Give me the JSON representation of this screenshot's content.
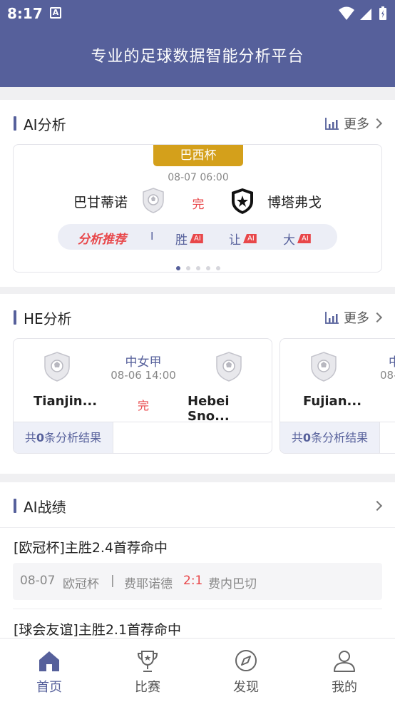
{
  "status_bar": {
    "time": "8:17",
    "notif_icon": "A"
  },
  "header": {
    "title": "专业的足球数据智能分析平台"
  },
  "ai_section": {
    "title": "AI分析",
    "more": "更多",
    "match": {
      "cup": "巴西杯",
      "datetime": "08-07 06:00",
      "home": "巴甘蒂诺",
      "away": "博塔弗戈",
      "status": "完"
    },
    "recommend": {
      "title": "分析推荐",
      "sep": "I",
      "items": [
        {
          "label": "胜",
          "badge": "AI"
        },
        {
          "label": "让",
          "badge": "AI"
        },
        {
          "label": "大",
          "badge": "AI"
        }
      ]
    },
    "pager": {
      "count": 5,
      "active": 0
    }
  },
  "he_section": {
    "title": "HE分析",
    "more": "更多",
    "matches": [
      {
        "league": "中女甲",
        "datetime": "08-06 14:00",
        "home": "Tianjin...",
        "away": "Hebei Sno...",
        "status": "完",
        "footer_prefix": "共",
        "footer_count": "0",
        "footer_suffix": "条分析结果"
      },
      {
        "league": "中",
        "datetime": "08-",
        "home": "Fujian...",
        "away": "",
        "status": "",
        "footer_prefix": "共",
        "footer_count": "0",
        "footer_suffix": "条分析结果"
      }
    ]
  },
  "record_section": {
    "title": "AI战绩",
    "items": [
      {
        "title": "[欧冠杯]主胜2.4首荐命中",
        "date": "08-07",
        "league": "欧冠杯",
        "sep": "|",
        "home": "费耶诺德",
        "score": "2:1",
        "away": "费内巴切"
      },
      {
        "title": "[球会友谊]主胜2.1首荐命中"
      }
    ]
  },
  "tabbar": {
    "tabs": [
      {
        "label": "首页",
        "icon": "home-icon",
        "active": true
      },
      {
        "label": "比赛",
        "icon": "trophy-icon",
        "active": false
      },
      {
        "label": "发现",
        "icon": "compass-icon",
        "active": false
      },
      {
        "label": "我的",
        "icon": "user-icon",
        "active": false
      }
    ]
  },
  "colors": {
    "brand": "#56609b",
    "accent_red": "#e8474a",
    "gold": "#d4a01b"
  }
}
